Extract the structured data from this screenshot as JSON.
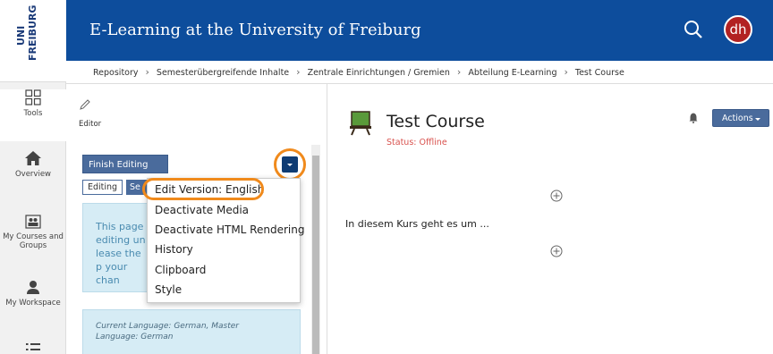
{
  "logo": {
    "text": "UNI FREIBURG"
  },
  "header": {
    "title": "E-Learning at the University of Freiburg",
    "avatar_initials": "dh",
    "search_icon": "search-icon"
  },
  "breadcrumb": [
    "Repository",
    "Semesterübergreifende Inhalte",
    "Zentrale Einrichtungen / Gremien",
    "Abteilung E-Learning",
    "Test Course"
  ],
  "rail": {
    "items": [
      {
        "label": "Tools",
        "icon": "grid-icon"
      },
      {
        "label": "Overview",
        "icon": "home-icon"
      },
      {
        "label": "My Courses and Groups",
        "icon": "group-icon"
      },
      {
        "label": "My Workspace",
        "icon": "user-icon"
      }
    ]
  },
  "slate": {
    "tool_label": "Editor",
    "finish_editing": "Finish Editing",
    "tab_editing": "Editing",
    "tab_settings": "Se",
    "info_text": "This page editing un lease the p your chan",
    "language_note": "Current Language: German, Master Language: German"
  },
  "menu": {
    "items": [
      "Edit Version: English",
      "Deactivate Media",
      "Deactivate HTML Rendering",
      "History",
      "Clipboard",
      "Style"
    ]
  },
  "main": {
    "course_title": "Test Course",
    "status": "Status: Offline",
    "actions": "Actions",
    "description": "In diesem Kurs geht es um ..."
  },
  "colors": {
    "header_blue": "#0d4d9c",
    "highlight_orange": "#f08a1c",
    "button_blue": "#4a6b9c",
    "status_red": "#d9534f"
  }
}
